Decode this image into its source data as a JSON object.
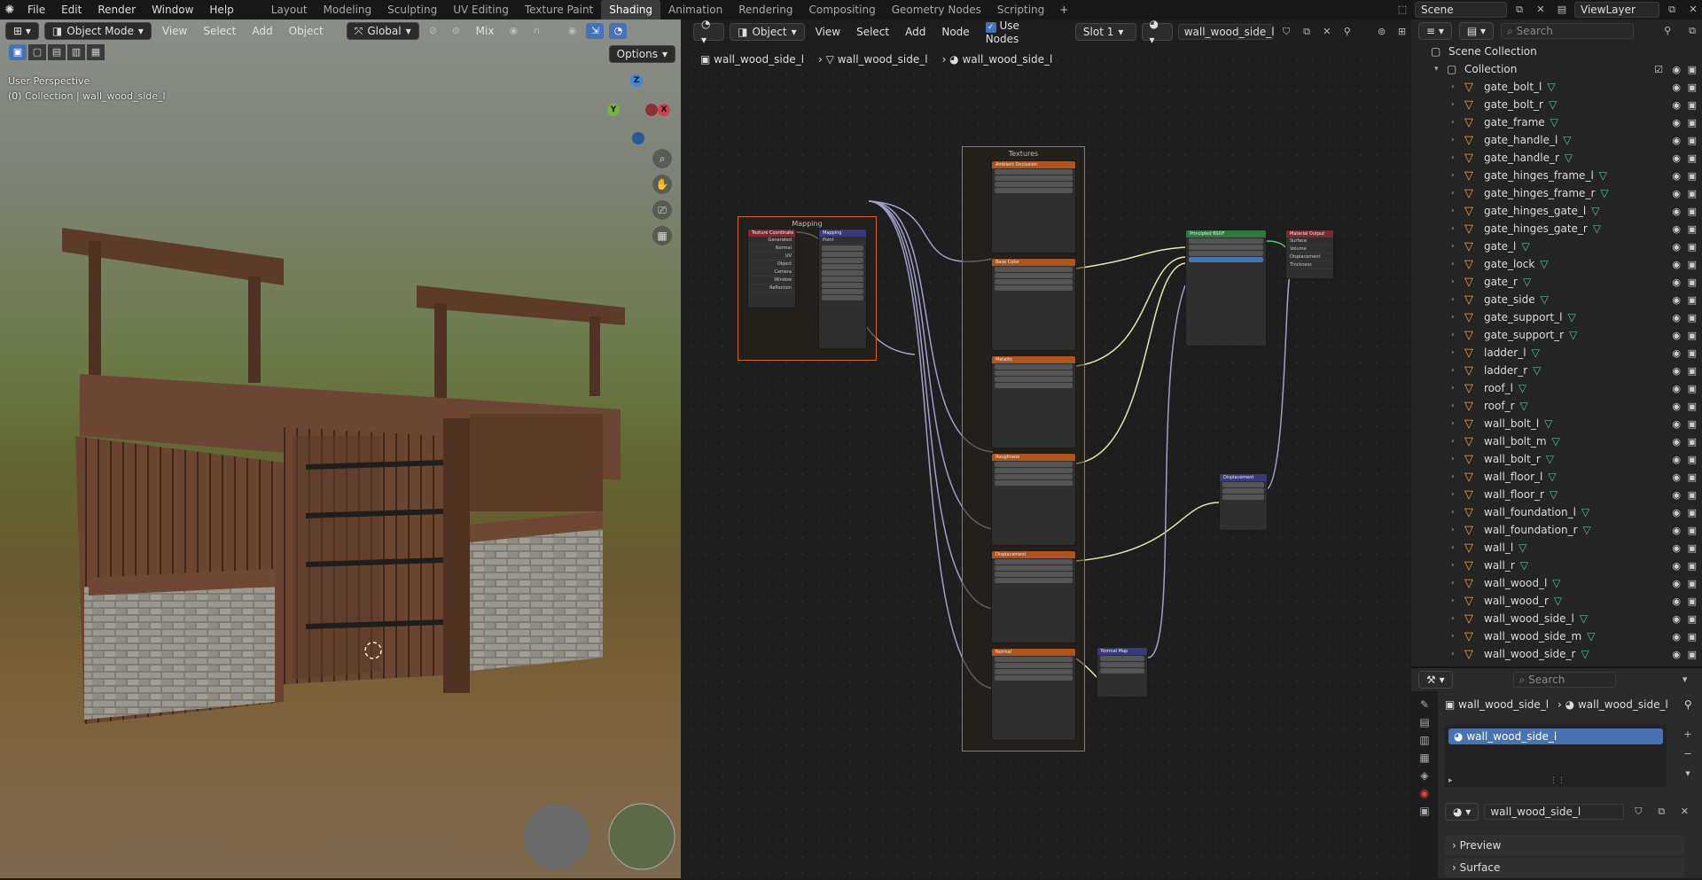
{
  "topbar": {
    "menus": [
      "File",
      "Edit",
      "Render",
      "Window",
      "Help"
    ],
    "workspaces": [
      "Layout",
      "Modeling",
      "Sculpting",
      "UV Editing",
      "Texture Paint",
      "Shading",
      "Animation",
      "Rendering",
      "Compositing",
      "Geometry Nodes",
      "Scripting"
    ],
    "active_workspace": "Shading",
    "scene": "Scene",
    "view_layer": "ViewLayer"
  },
  "viewport": {
    "mode": "Object Mode",
    "menus": [
      "View",
      "Select",
      "Add",
      "Object"
    ],
    "transform": "Global",
    "snap_mode": "Mix",
    "options": "Options",
    "perspective": "User Perspective",
    "collection_info": "(0) Collection | wall_wood_side_l",
    "axes": {
      "z": "Z",
      "x": "X",
      "y": "Y"
    }
  },
  "node_editor": {
    "editor_type": "Object",
    "menus": [
      "View",
      "Select",
      "Add",
      "Node"
    ],
    "use_nodes_label": "Use Nodes",
    "slot": "Slot 1",
    "material_name": "wall_wood_side_l",
    "breadcrumb": [
      "wall_wood_side_l",
      "wall_wood_side_l",
      "wall_wood_side_l"
    ],
    "frames": {
      "mapping": "Mapping",
      "textures": "Textures"
    },
    "nodes": {
      "tex_coord": "Texture Coordinate",
      "tex_coord_outputs": [
        "Generated",
        "Normal",
        "UV",
        "Object",
        "Camera",
        "Window",
        "Reflection"
      ],
      "mapping": "Mapping",
      "mapping_type": "Point",
      "ao": "Ambient Occlusion",
      "base_color": "Base Color",
      "metallic": "Metallic",
      "roughness": "Roughness",
      "displacement_tex": "Displacement",
      "normal_tex": "Normal",
      "bsdf": "Principled BSDF",
      "output": "Material Output",
      "output_sockets": [
        "Surface",
        "Volume",
        "Displacement",
        "Thickness"
      ],
      "displacement": "Displacement",
      "normal_map": "Normal Map"
    }
  },
  "outliner": {
    "search_placeholder": "Search",
    "scene_collection": "Scene Collection",
    "collection": "Collection",
    "items": [
      "gate_bolt_l",
      "gate_bolt_r",
      "gate_frame",
      "gate_handle_l",
      "gate_handle_r",
      "gate_hinges_frame_l",
      "gate_hinges_frame_r",
      "gate_hinges_gate_l",
      "gate_hinges_gate_r",
      "gate_l",
      "gate_lock",
      "gate_r",
      "gate_side",
      "gate_support_l",
      "gate_support_r",
      "ladder_l",
      "ladder_r",
      "roof_l",
      "roof_r",
      "wall_bolt_l",
      "wall_bolt_m",
      "wall_bolt_r",
      "wall_floor_l",
      "wall_floor_r",
      "wall_foundation_l",
      "wall_foundation_r",
      "wall_l",
      "wall_r",
      "wall_wood_l",
      "wall_wood_r",
      "wall_wood_side_l",
      "wall_wood_side_m",
      "wall_wood_side_r"
    ]
  },
  "properties": {
    "search_placeholder": "Search",
    "object_name": "wall_wood_side_l",
    "material_crumb": "wall_wood_side_l",
    "slot_item": "wall_wood_side_l",
    "material_field": "wall_wood_side_l",
    "preview": "Preview",
    "surface": "Surface"
  }
}
